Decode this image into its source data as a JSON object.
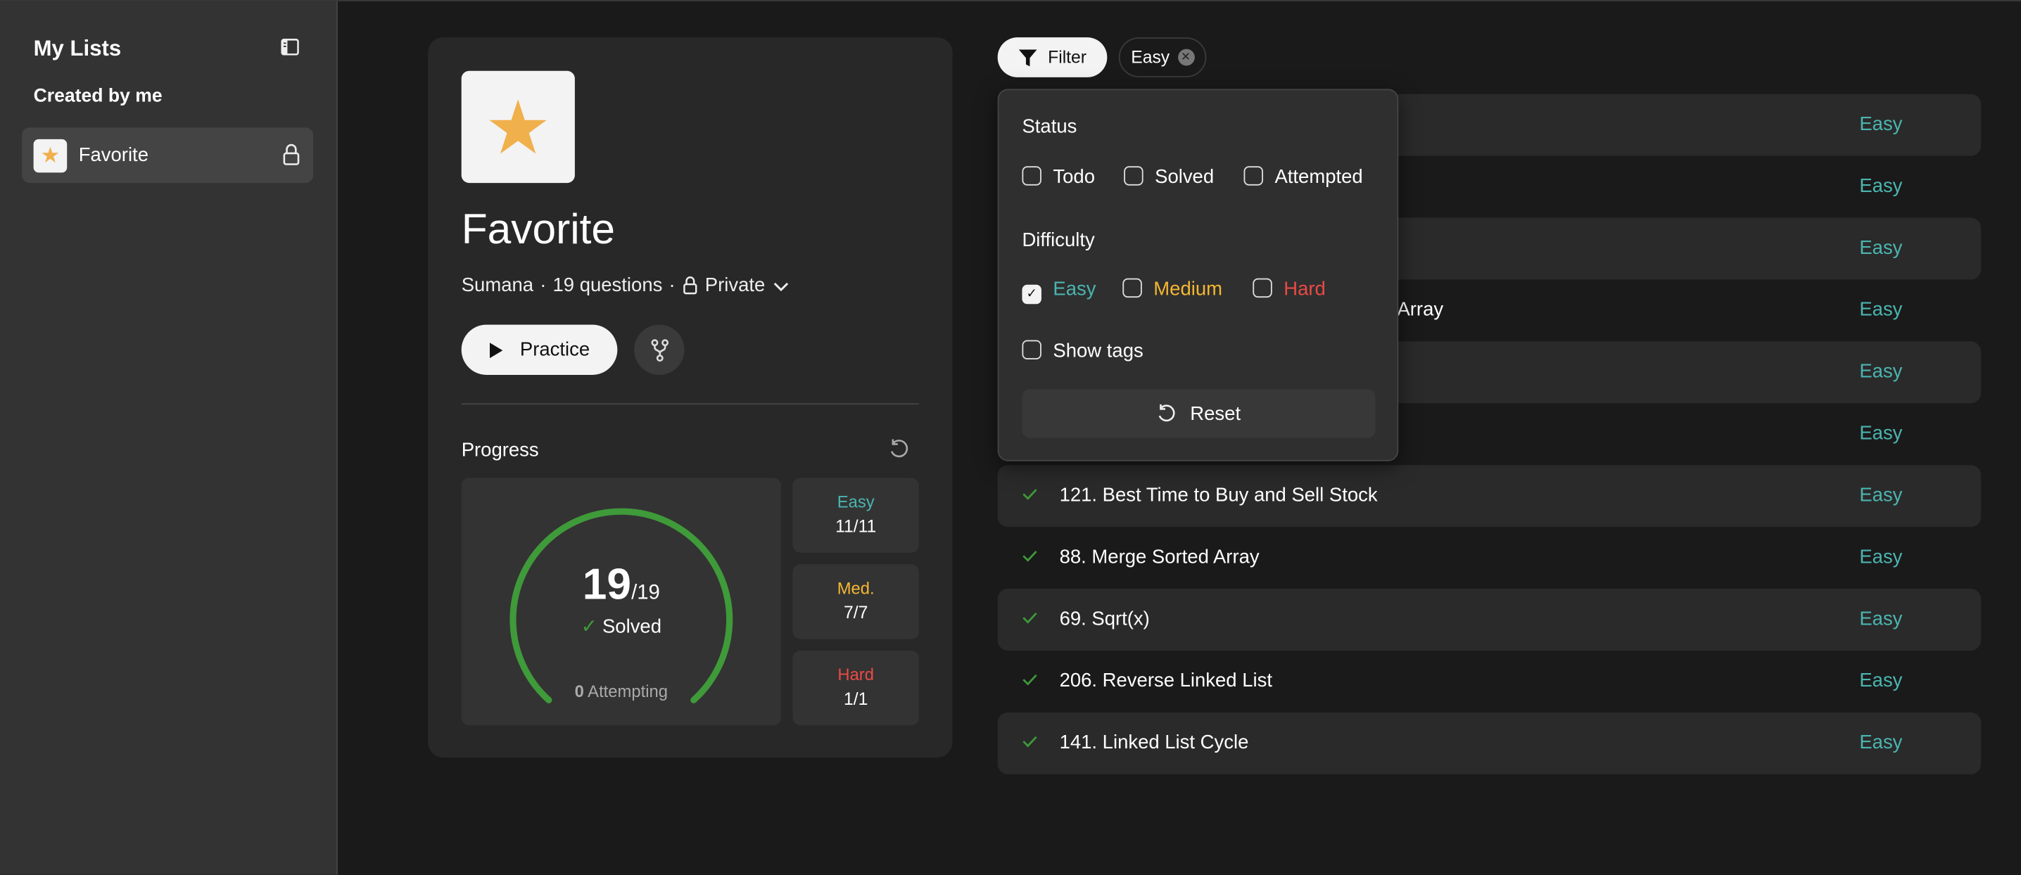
{
  "sidebar": {
    "title": "My Lists",
    "section": "Created by me",
    "items": [
      {
        "label": "Favorite",
        "locked": true
      }
    ]
  },
  "list": {
    "title": "Favorite",
    "owner": "Sumana",
    "sep": "·",
    "questions": "19 questions",
    "visibility": "Private",
    "practice_label": "Practice"
  },
  "progress": {
    "label": "Progress",
    "solved": 19,
    "total": 19,
    "solved_label": "Solved",
    "attempting": 0,
    "attempting_label": "Attempting",
    "solved_str": "19",
    "total_str": "/19",
    "attempting_str": "0",
    "breakdown": [
      {
        "label": "Easy",
        "value": "11/11",
        "color": "#4bb5b0"
      },
      {
        "label": "Med.",
        "value": "7/7",
        "color": "#f5b731"
      },
      {
        "label": "Hard",
        "value": "1/1",
        "color": "#ea4a45"
      }
    ],
    "arc_color": "#3f9a3a"
  },
  "filter": {
    "label": "Filter",
    "chip": "Easy",
    "status_heading": "Status",
    "status_options": [
      {
        "label": "Todo",
        "checked": false
      },
      {
        "label": "Solved",
        "checked": false
      },
      {
        "label": "Attempted",
        "checked": false
      }
    ],
    "difficulty_heading": "Difficulty",
    "difficulty_options": [
      {
        "label": "Easy",
        "checked": true,
        "color": "#4bb5b0"
      },
      {
        "label": "Medium",
        "checked": false,
        "color": "#f5b731"
      },
      {
        "label": "Hard",
        "checked": false,
        "color": "#ea4a45"
      }
    ],
    "show_tags": "Show tags",
    "reset": "Reset"
  },
  "questions": [
    {
      "title": "",
      "difficulty": "Easy"
    },
    {
      "title": "",
      "difficulty": "Easy"
    },
    {
      "title": "",
      "difficulty": "Easy"
    },
    {
      "title": "Array",
      "difficulty": "Easy"
    },
    {
      "title": "",
      "difficulty": "Easy"
    },
    {
      "title": "",
      "difficulty": "Easy"
    },
    {
      "title": "121. Best Time to Buy and Sell Stock",
      "difficulty": "Easy",
      "solved": true
    },
    {
      "title": "88. Merge Sorted Array",
      "difficulty": "Easy",
      "solved": true
    },
    {
      "title": "69. Sqrt(x)",
      "difficulty": "Easy",
      "solved": true
    },
    {
      "title": "206. Reverse Linked List",
      "difficulty": "Easy",
      "solved": true
    },
    {
      "title": "141. Linked List Cycle",
      "difficulty": "Easy",
      "solved": true
    }
  ]
}
